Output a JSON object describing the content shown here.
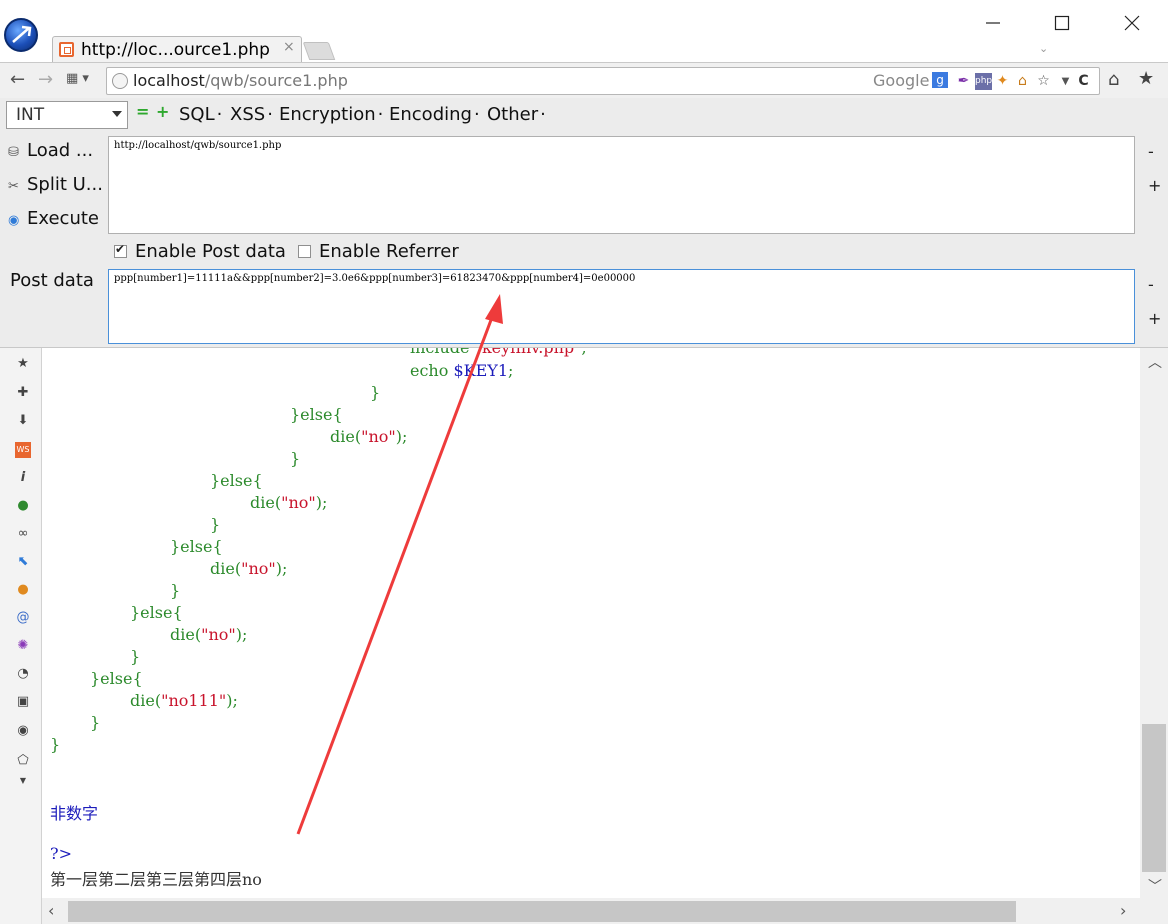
{
  "window": {
    "tab_title": "http://loc...ource1.php",
    "tab_close": "×",
    "minimize": "—",
    "maximize": "☐",
    "close": "✕",
    "tab_list": "⌄"
  },
  "navbar": {
    "back": "←",
    "forward": "→",
    "url_host": "localhost",
    "url_path": "/qwb/source1.php",
    "search_engine": "Google",
    "search_engine_icon": "g",
    "reload": "C",
    "home": "⌂",
    "bookmarks": "★"
  },
  "hackbar": {
    "encoding_select": "INT",
    "menus": [
      "SQL",
      "XSS",
      "Encryption",
      "Encoding",
      "Other"
    ],
    "load_url": "Load ...",
    "split_url": "Split U...",
    "execute": "Execute",
    "url_value": "http://localhost/qwb/source1.php",
    "enable_post_label": "Enable Post data",
    "enable_post_checked": true,
    "enable_referrer_label": "Enable Referrer",
    "enable_referrer_checked": false,
    "post_label": "Post data",
    "post_value": "ppp[number1]=11111a&&ppp[number2]=3.0e6&ppp[number3]=61823470&ppp[number4]=0e00000",
    "split_minus": "-",
    "split_plus": "+"
  },
  "code_lines": [
    "include \"keyfinv.php\";",
    "echo $KEY1;",
    "}",
    "}else{",
    "die(\"no\");",
    "}",
    "}else{",
    "die(\"no\");",
    "}",
    "}else{",
    "die(\"no\");",
    "}",
    "}else{",
    "die(\"no\");",
    "}",
    "}else{",
    "die(\"no111\");",
    "}",
    "}",
    "非数字",
    "?>",
    "第一层第二层第三层第四层no"
  ],
  "colors": {
    "keyword_green": "#2c8a2c",
    "string_red": "#c8132b",
    "variable_blue": "#1c1cbb",
    "annotation_arrow": "#ee3b3b",
    "post_border": "#4a90d9"
  }
}
